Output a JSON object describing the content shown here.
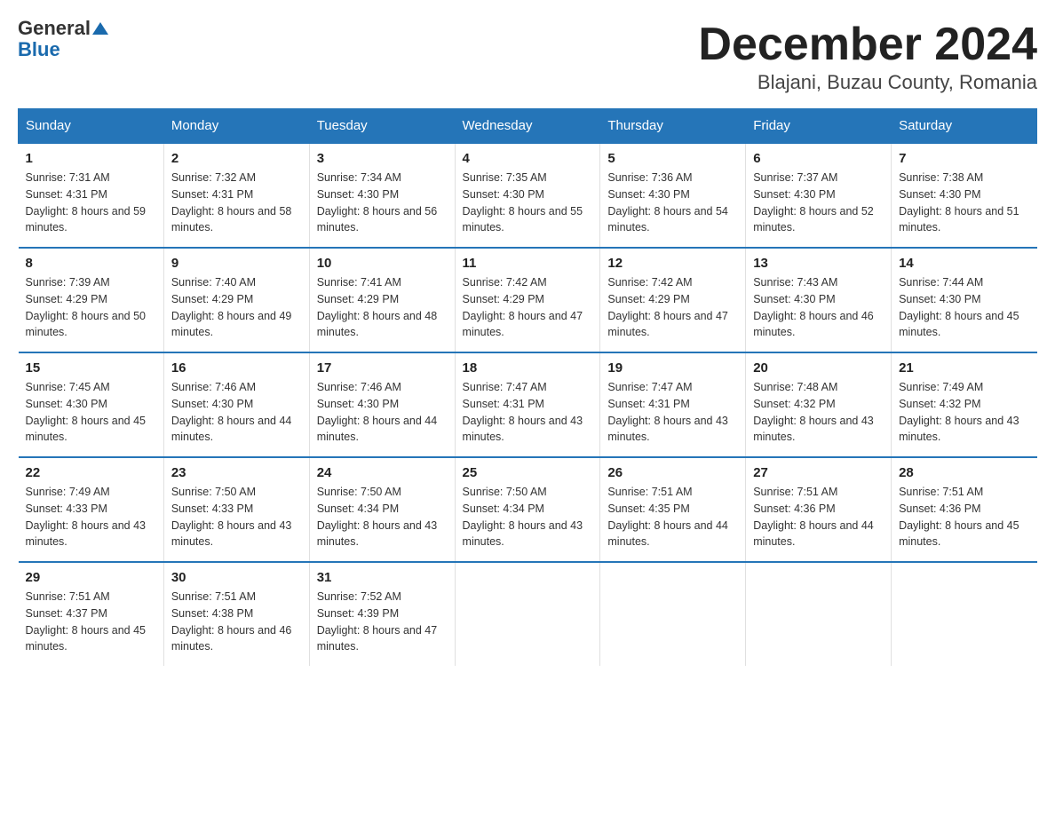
{
  "header": {
    "logo_general": "General",
    "logo_blue": "Blue",
    "title": "December 2024",
    "subtitle": "Blajani, Buzau County, Romania"
  },
  "days_of_week": [
    "Sunday",
    "Monday",
    "Tuesday",
    "Wednesday",
    "Thursday",
    "Friday",
    "Saturday"
  ],
  "weeks": [
    [
      {
        "day": "1",
        "sunrise": "7:31 AM",
        "sunset": "4:31 PM",
        "daylight": "8 hours and 59 minutes."
      },
      {
        "day": "2",
        "sunrise": "7:32 AM",
        "sunset": "4:31 PM",
        "daylight": "8 hours and 58 minutes."
      },
      {
        "day": "3",
        "sunrise": "7:34 AM",
        "sunset": "4:30 PM",
        "daylight": "8 hours and 56 minutes."
      },
      {
        "day": "4",
        "sunrise": "7:35 AM",
        "sunset": "4:30 PM",
        "daylight": "8 hours and 55 minutes."
      },
      {
        "day": "5",
        "sunrise": "7:36 AM",
        "sunset": "4:30 PM",
        "daylight": "8 hours and 54 minutes."
      },
      {
        "day": "6",
        "sunrise": "7:37 AM",
        "sunset": "4:30 PM",
        "daylight": "8 hours and 52 minutes."
      },
      {
        "day": "7",
        "sunrise": "7:38 AM",
        "sunset": "4:30 PM",
        "daylight": "8 hours and 51 minutes."
      }
    ],
    [
      {
        "day": "8",
        "sunrise": "7:39 AM",
        "sunset": "4:29 PM",
        "daylight": "8 hours and 50 minutes."
      },
      {
        "day": "9",
        "sunrise": "7:40 AM",
        "sunset": "4:29 PM",
        "daylight": "8 hours and 49 minutes."
      },
      {
        "day": "10",
        "sunrise": "7:41 AM",
        "sunset": "4:29 PM",
        "daylight": "8 hours and 48 minutes."
      },
      {
        "day": "11",
        "sunrise": "7:42 AM",
        "sunset": "4:29 PM",
        "daylight": "8 hours and 47 minutes."
      },
      {
        "day": "12",
        "sunrise": "7:42 AM",
        "sunset": "4:29 PM",
        "daylight": "8 hours and 47 minutes."
      },
      {
        "day": "13",
        "sunrise": "7:43 AM",
        "sunset": "4:30 PM",
        "daylight": "8 hours and 46 minutes."
      },
      {
        "day": "14",
        "sunrise": "7:44 AM",
        "sunset": "4:30 PM",
        "daylight": "8 hours and 45 minutes."
      }
    ],
    [
      {
        "day": "15",
        "sunrise": "7:45 AM",
        "sunset": "4:30 PM",
        "daylight": "8 hours and 45 minutes."
      },
      {
        "day": "16",
        "sunrise": "7:46 AM",
        "sunset": "4:30 PM",
        "daylight": "8 hours and 44 minutes."
      },
      {
        "day": "17",
        "sunrise": "7:46 AM",
        "sunset": "4:30 PM",
        "daylight": "8 hours and 44 minutes."
      },
      {
        "day": "18",
        "sunrise": "7:47 AM",
        "sunset": "4:31 PM",
        "daylight": "8 hours and 43 minutes."
      },
      {
        "day": "19",
        "sunrise": "7:47 AM",
        "sunset": "4:31 PM",
        "daylight": "8 hours and 43 minutes."
      },
      {
        "day": "20",
        "sunrise": "7:48 AM",
        "sunset": "4:32 PM",
        "daylight": "8 hours and 43 minutes."
      },
      {
        "day": "21",
        "sunrise": "7:49 AM",
        "sunset": "4:32 PM",
        "daylight": "8 hours and 43 minutes."
      }
    ],
    [
      {
        "day": "22",
        "sunrise": "7:49 AM",
        "sunset": "4:33 PM",
        "daylight": "8 hours and 43 minutes."
      },
      {
        "day": "23",
        "sunrise": "7:50 AM",
        "sunset": "4:33 PM",
        "daylight": "8 hours and 43 minutes."
      },
      {
        "day": "24",
        "sunrise": "7:50 AM",
        "sunset": "4:34 PM",
        "daylight": "8 hours and 43 minutes."
      },
      {
        "day": "25",
        "sunrise": "7:50 AM",
        "sunset": "4:34 PM",
        "daylight": "8 hours and 43 minutes."
      },
      {
        "day": "26",
        "sunrise": "7:51 AM",
        "sunset": "4:35 PM",
        "daylight": "8 hours and 44 minutes."
      },
      {
        "day": "27",
        "sunrise": "7:51 AM",
        "sunset": "4:36 PM",
        "daylight": "8 hours and 44 minutes."
      },
      {
        "day": "28",
        "sunrise": "7:51 AM",
        "sunset": "4:36 PM",
        "daylight": "8 hours and 45 minutes."
      }
    ],
    [
      {
        "day": "29",
        "sunrise": "7:51 AM",
        "sunset": "4:37 PM",
        "daylight": "8 hours and 45 minutes."
      },
      {
        "day": "30",
        "sunrise": "7:51 AM",
        "sunset": "4:38 PM",
        "daylight": "8 hours and 46 minutes."
      },
      {
        "day": "31",
        "sunrise": "7:52 AM",
        "sunset": "4:39 PM",
        "daylight": "8 hours and 47 minutes."
      },
      null,
      null,
      null,
      null
    ]
  ],
  "labels": {
    "sunrise": "Sunrise:",
    "sunset": "Sunset:",
    "daylight": "Daylight:"
  }
}
